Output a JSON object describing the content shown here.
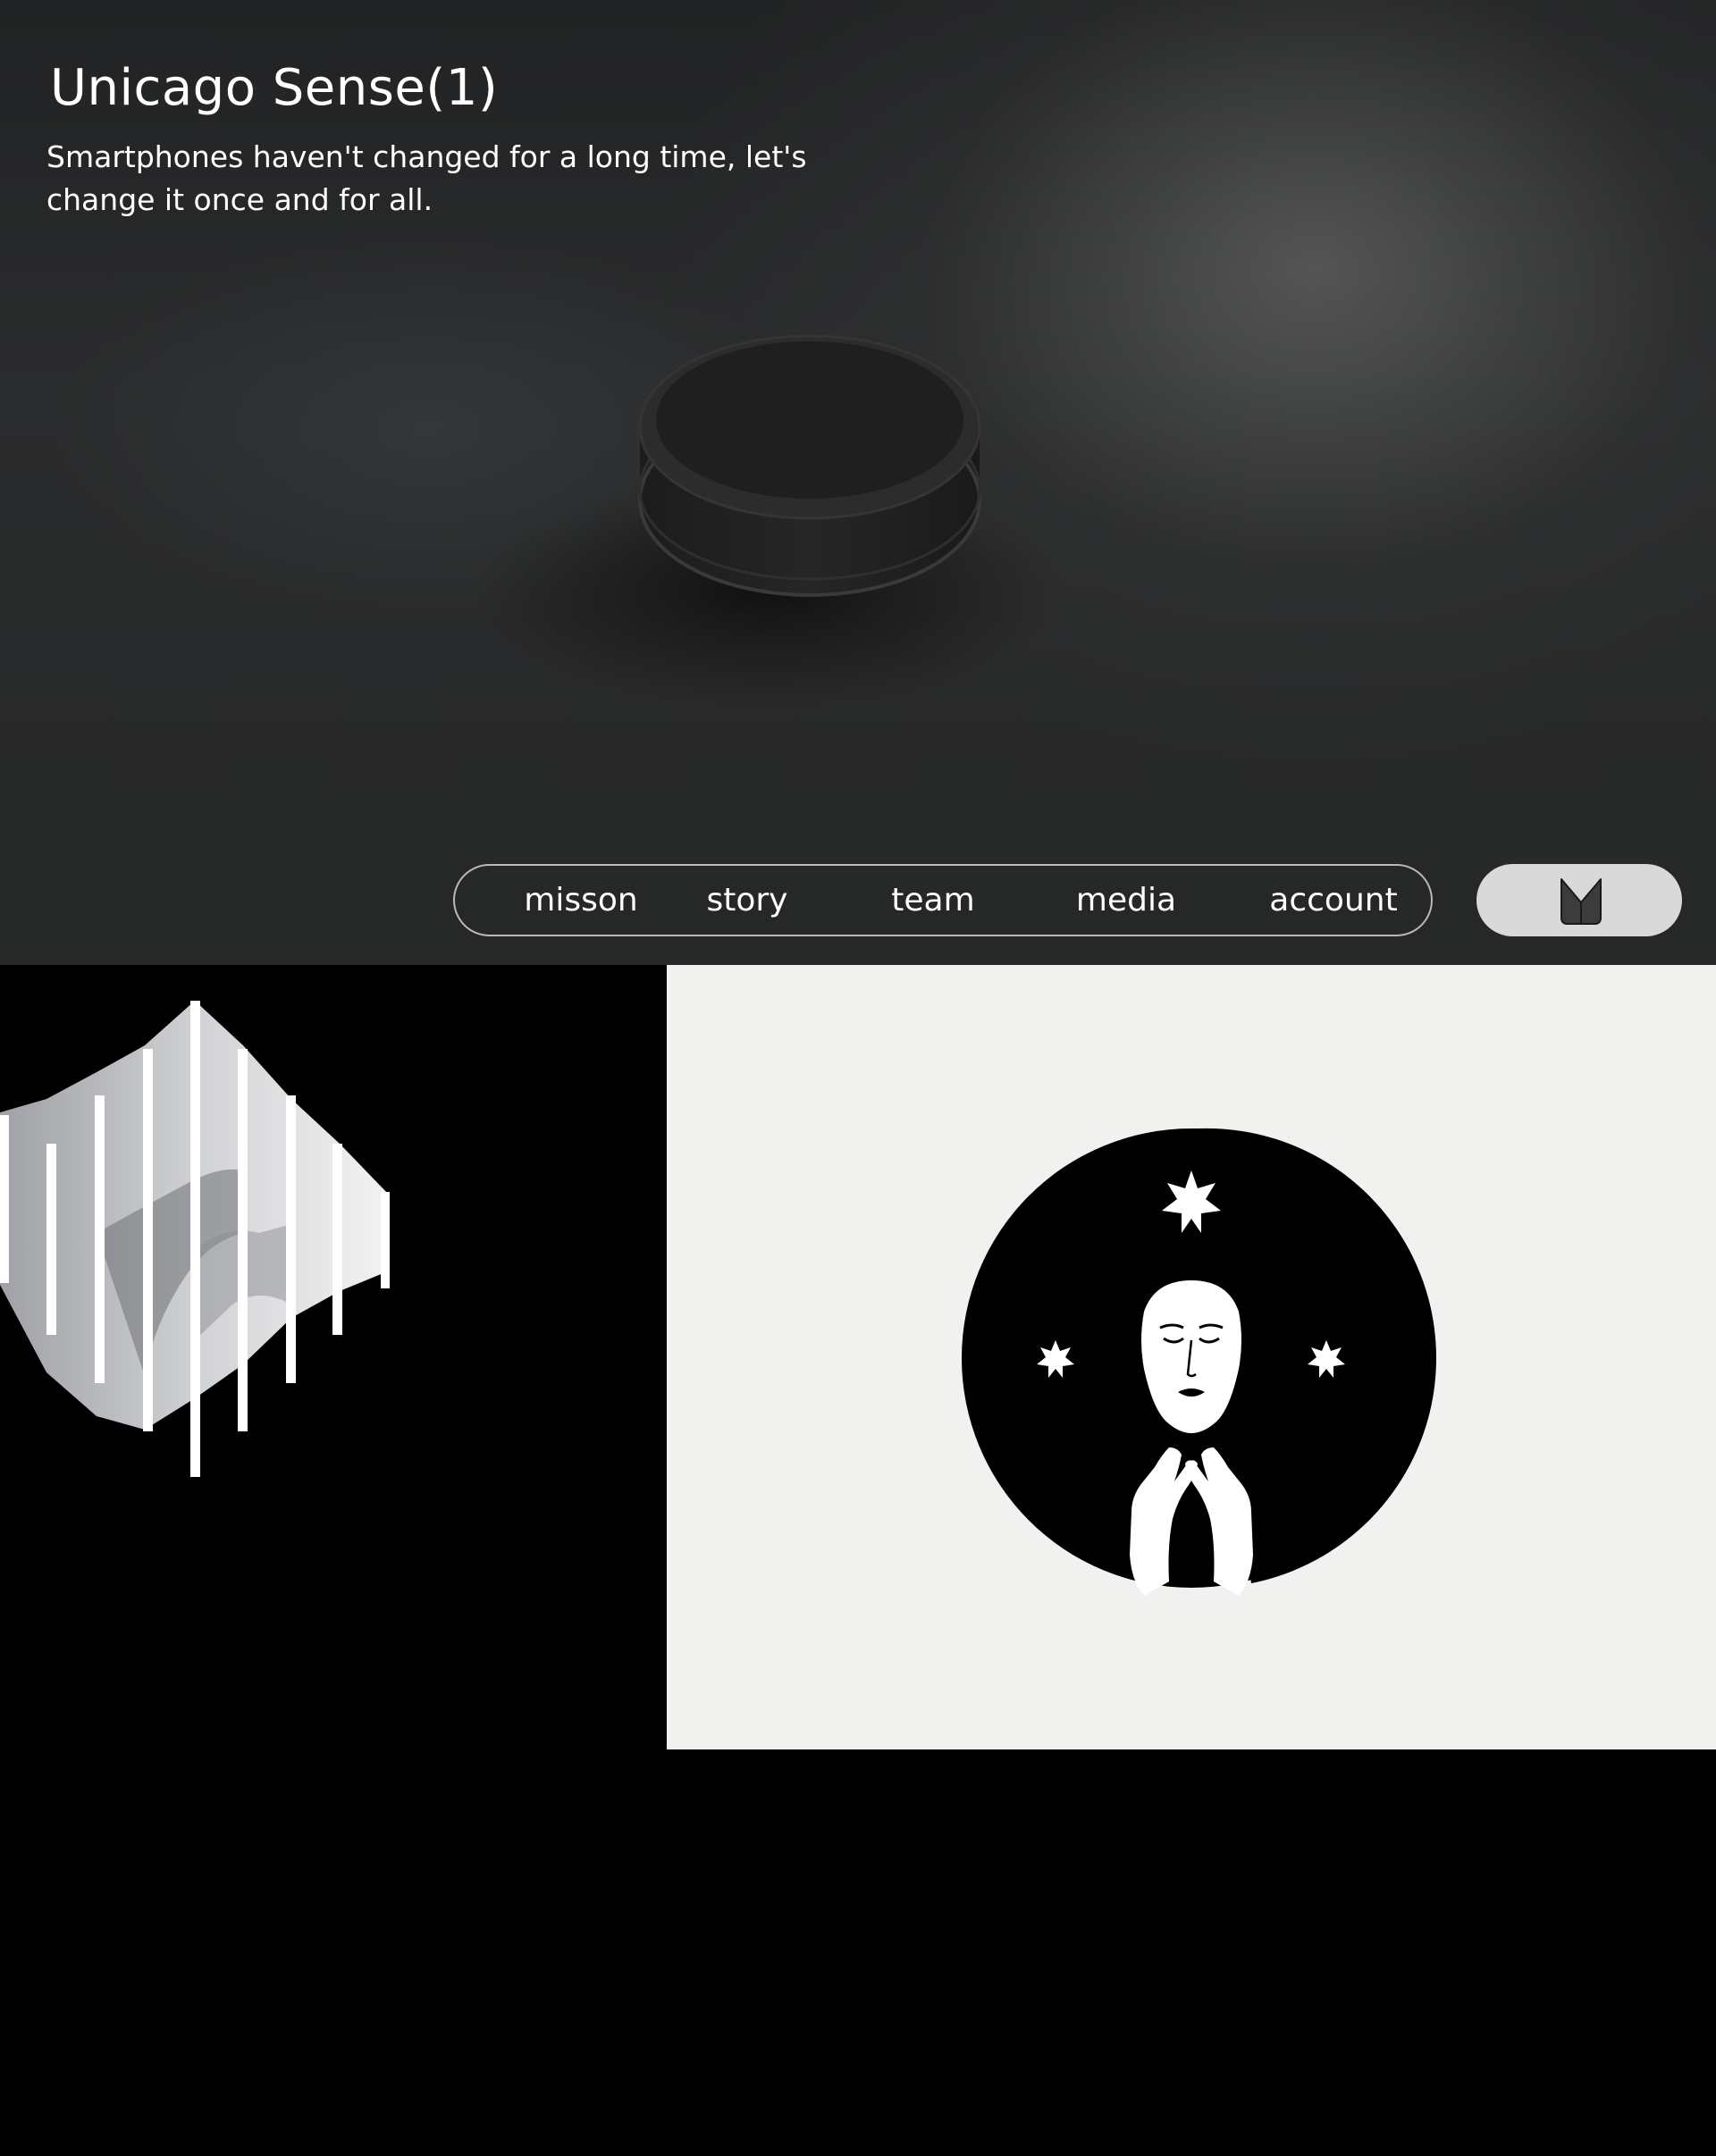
{
  "hero": {
    "title": "Unicago Sense(1)",
    "subtitle_line1": "Smartphones haven't changed for a long time, let's",
    "subtitle_line2": "change it once and for all.",
    "product_image": "round-dark-device"
  },
  "nav": {
    "items": [
      "misson",
      "story",
      "team",
      "media",
      "account"
    ],
    "logo_icon": "brand-logo-icon"
  },
  "gallery": {
    "left_image": "3d-wave-sculpture",
    "right_image": "face-with-hands-and-stars-emblem"
  },
  "colors": {
    "hero_bg": "#2a2b2c",
    "nav_border": "#b9b9b9",
    "logo_button_bg": "#d9d9d9",
    "art_panel_bg": "#f1f1ef",
    "page_bg": "#000000"
  }
}
